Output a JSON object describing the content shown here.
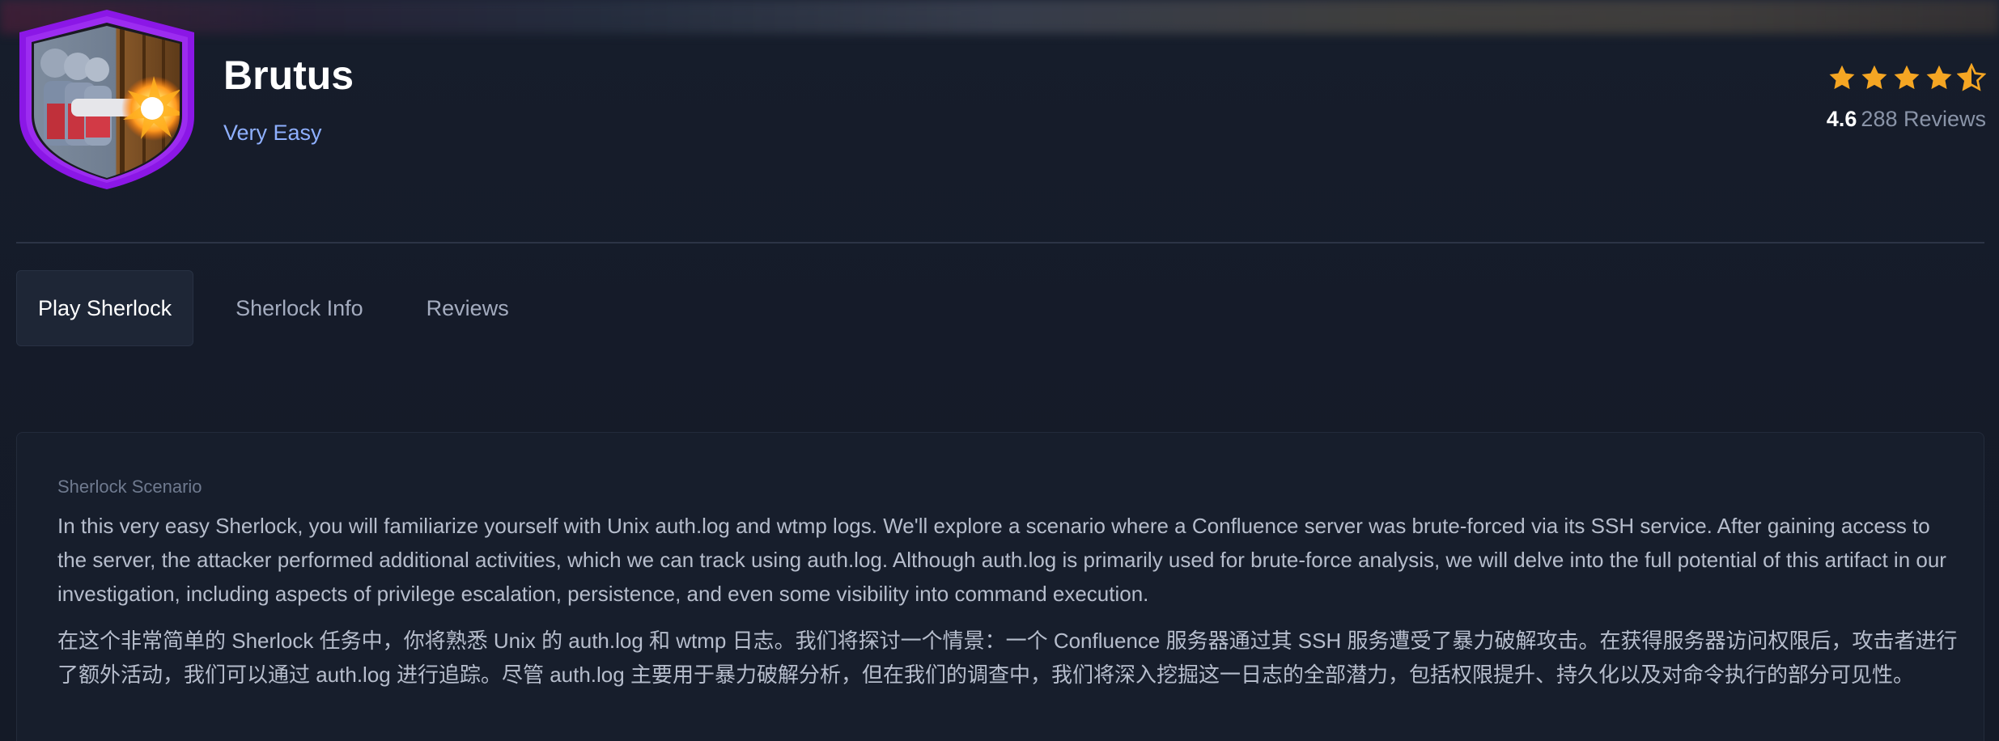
{
  "machine": {
    "name": "Brutus",
    "difficulty": "Very Easy",
    "badge_icon": "sherlock-badge-icon"
  },
  "rating": {
    "value": "4.6",
    "reviews_label": "288 Reviews",
    "stars": 4.6,
    "star_color": "#f5a623"
  },
  "tabs": [
    {
      "label": "Play Sherlock",
      "active": true
    },
    {
      "label": "Sherlock Info",
      "active": false
    },
    {
      "label": "Reviews",
      "active": false
    }
  ],
  "scenario": {
    "label": "Sherlock Scenario",
    "text_en": "In this very easy Sherlock, you will familiarize yourself with Unix auth.log and wtmp logs. We'll explore a scenario where a Confluence server was brute-forced via its SSH service. After gaining access to the server, the attacker performed additional activities, which we can track using auth.log. Although auth.log is primarily used for brute-force analysis, we will delve into the full potential of this artifact in our investigation, including aspects of privilege escalation, persistence, and even some visibility into command execution.",
    "text_zh": "在这个非常简单的 Sherlock 任务中，你将熟悉 Unix 的 auth.log 和 wtmp 日志。我们将探讨一个情景：一个 Confluence 服务器通过其 SSH 服务遭受了暴力破解攻击。在获得服务器访问权限后，攻击者进行了额外活动，我们可以通过 auth.log 进行追踪。尽管 auth.log 主要用于暴力破解分析，但在我们的调查中，我们将深入挖掘这一日志的全部潜力，包括权限提升、持久化以及对命令执行的部分可见性。"
  },
  "colors": {
    "accent_purple": "#8b17e6",
    "difficulty_blue": "#8fb0ff",
    "background": "#151b29"
  }
}
